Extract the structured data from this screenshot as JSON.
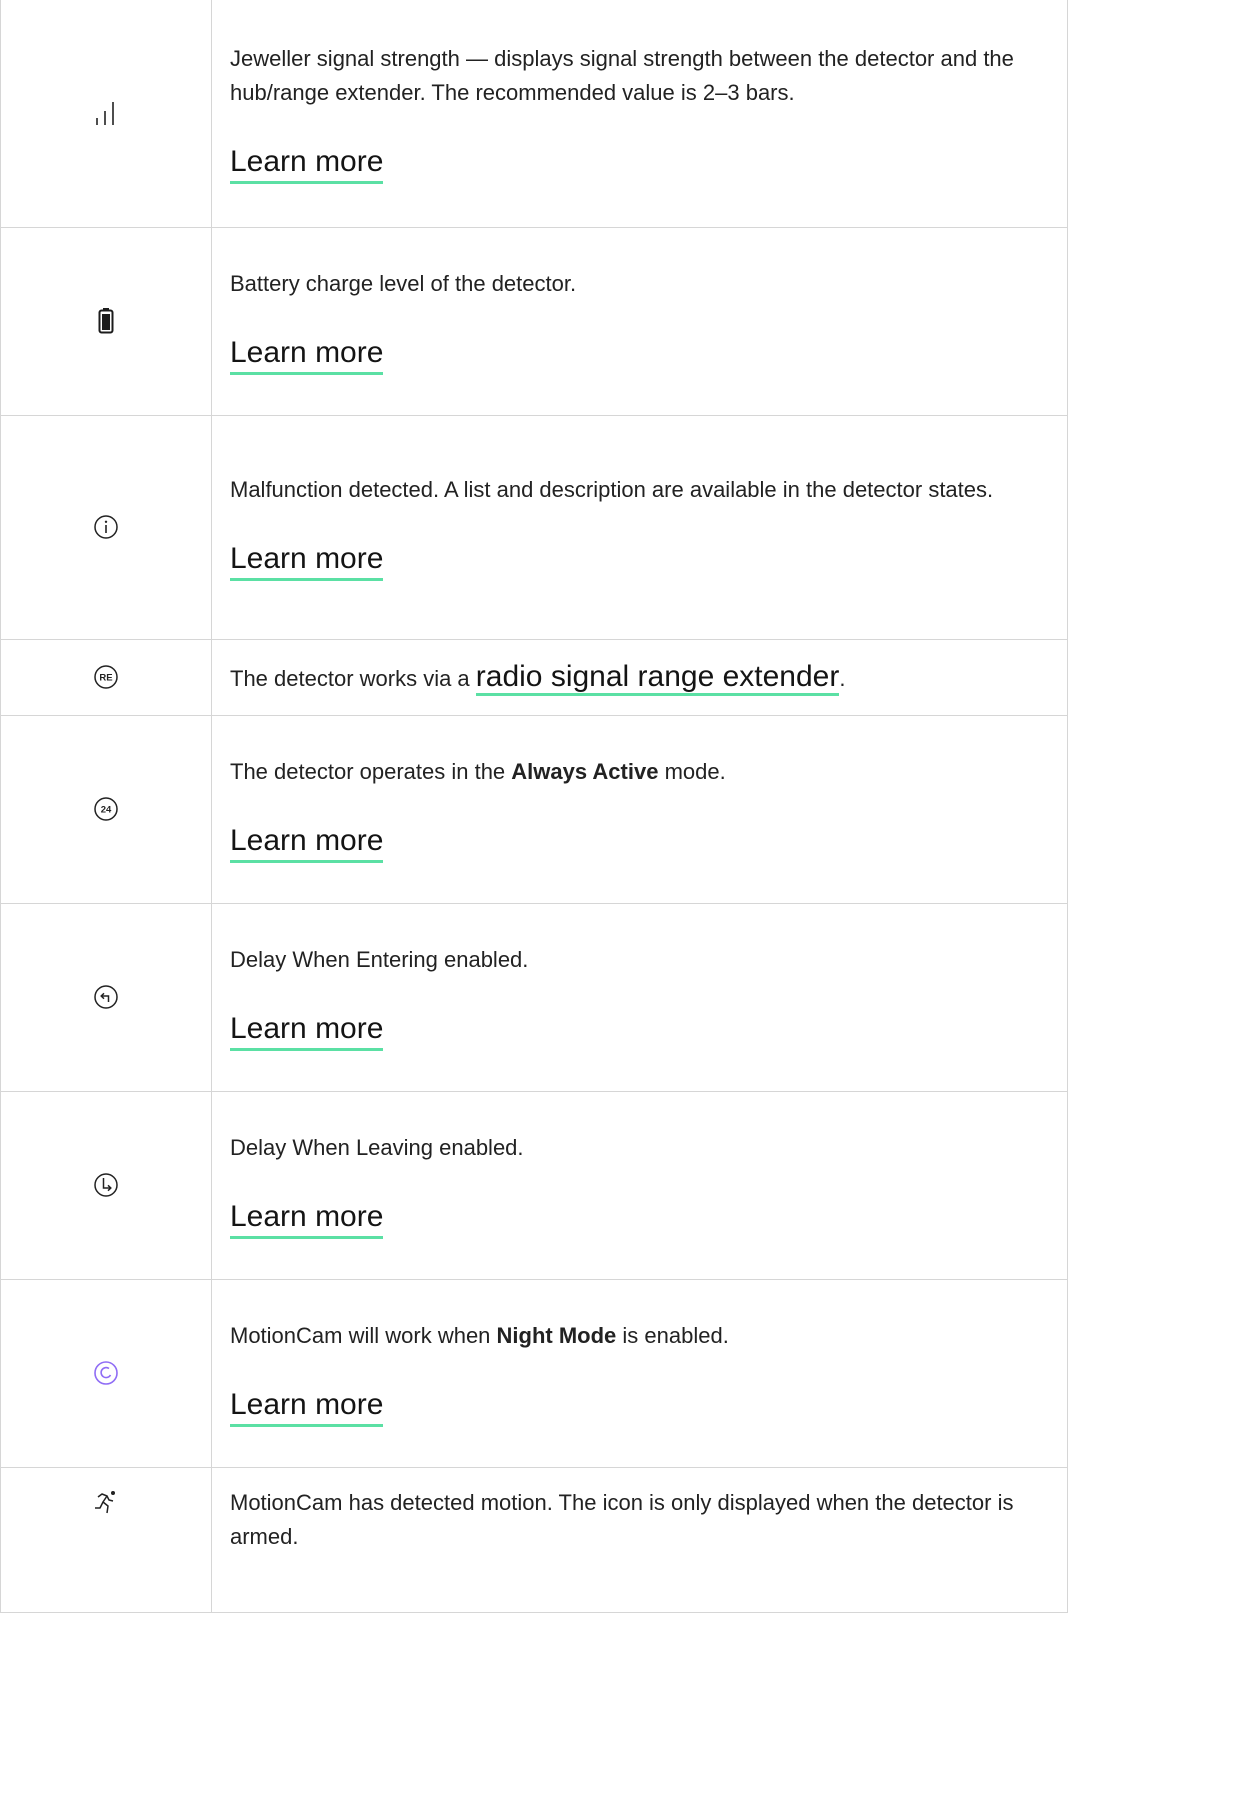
{
  "rows": [
    {
      "icon": "signal-strength-icon",
      "text": "Jeweller signal strength — displays signal strength between the detector and the hub/range extender. The recommended value is 2–3 bars.",
      "link": "Learn more"
    },
    {
      "icon": "battery-icon",
      "text": "Battery charge level of the detector.",
      "link": "Learn more"
    },
    {
      "icon": "info-icon",
      "text": "Malfunction detected. A list and description are available in the detector states.",
      "link": "Learn more"
    },
    {
      "icon": "range-extender-icon",
      "icon_text": "RE",
      "text_before": "The detector works via a ",
      "link": "radio signal range extender",
      "text_after": "."
    },
    {
      "icon": "always-active-icon",
      "icon_text": "24",
      "text_before": "The detector operates in the ",
      "bold": "Always Active",
      "text_after": " mode.",
      "link": "Learn more"
    },
    {
      "icon": "delay-entering-icon",
      "text": "Delay When Entering enabled.",
      "link": "Learn more"
    },
    {
      "icon": "delay-leaving-icon",
      "text": "Delay When Leaving enabled.",
      "link": "Learn more"
    },
    {
      "icon": "night-mode-icon",
      "text_before": "MotionCam will work when ",
      "bold": "Night Mode",
      "text_after": " is enabled.",
      "link": "Learn more"
    },
    {
      "icon": "motion-detected-icon",
      "text": "MotionCam has detected motion. The icon is only displayed when the detector is armed."
    }
  ],
  "colors": {
    "link_underline": "#5be0a4",
    "night_mode_icon": "#8f6cf5",
    "border": "#d6d6d6"
  }
}
